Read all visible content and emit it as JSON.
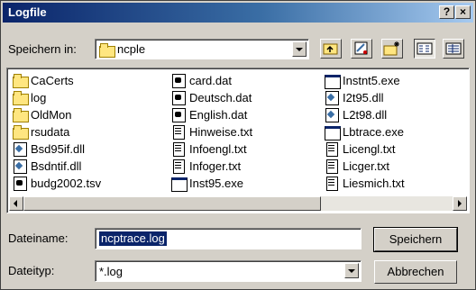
{
  "window": {
    "title": "Logfile",
    "help_button": "?",
    "close_button": "×"
  },
  "look_in": {
    "label": "Speichern in:",
    "value": "ncple"
  },
  "toolbar": {
    "icons": [
      "up-folder-icon",
      "desktop-icon",
      "new-folder-icon",
      "list-view-icon",
      "details-view-icon"
    ]
  },
  "files": {
    "columns": [
      [
        {
          "name": "CaCerts",
          "icon": "folder"
        },
        {
          "name": "log",
          "icon": "folder"
        },
        {
          "name": "OldMon",
          "icon": "folder"
        },
        {
          "name": "rsudata",
          "icon": "folder"
        },
        {
          "name": "Bsd95if.dll",
          "icon": "dll"
        },
        {
          "name": "Bsdntif.dll",
          "icon": "dll"
        },
        {
          "name": "budg2002.tsv",
          "icon": "dat"
        }
      ],
      [
        {
          "name": "card.dat",
          "icon": "dat"
        },
        {
          "name": "Deutsch.dat",
          "icon": "dat"
        },
        {
          "name": "English.dat",
          "icon": "dat"
        },
        {
          "name": "Hinweise.txt",
          "icon": "doc"
        },
        {
          "name": "Infoengl.txt",
          "icon": "doc"
        },
        {
          "name": "Infoger.txt",
          "icon": "doc"
        },
        {
          "name": "Inst95.exe",
          "icon": "exe"
        }
      ],
      [
        {
          "name": "Instnt5.exe",
          "icon": "exe"
        },
        {
          "name": "I2t95.dll",
          "icon": "dll"
        },
        {
          "name": "L2t98.dll",
          "icon": "dll"
        },
        {
          "name": "Lbtrace.exe",
          "icon": "exe"
        },
        {
          "name": "Licengl.txt",
          "icon": "doc"
        },
        {
          "name": "Licger.txt",
          "icon": "doc"
        },
        {
          "name": "Liesmich.txt",
          "icon": "doc"
        }
      ]
    ]
  },
  "filename": {
    "label": "Dateiname:",
    "value": "ncptrace.log"
  },
  "filetype": {
    "label": "Dateityp:",
    "value": "*.log"
  },
  "buttons": {
    "save": "Speichern",
    "cancel": "Abbrechen"
  },
  "colors": {
    "titlebar_start": "#0a246a",
    "titlebar_end": "#a6caf0",
    "face": "#d4d0c8",
    "selection": "#0a246a"
  }
}
